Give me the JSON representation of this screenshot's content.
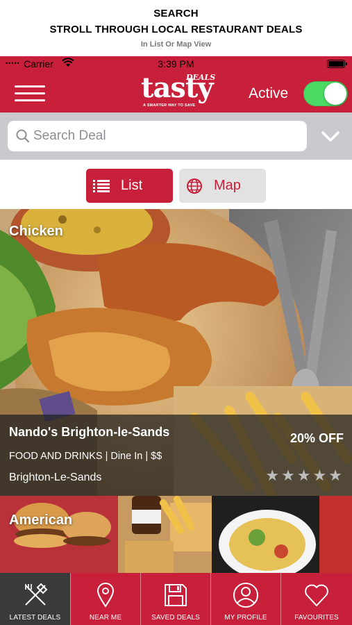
{
  "promo": {
    "line1": "SEARCH",
    "line2": "STROLL THROUGH LOCAL RESTAURANT DEALS",
    "line3": "In List Or Map View"
  },
  "status_bar": {
    "carrier": "Carrier",
    "time": "3:39 PM",
    "signal_dots": "•••••"
  },
  "header": {
    "logo_word": "tasty",
    "logo_deals": "DEALS",
    "logo_tagline": "A SMARTER WAY TO SAVE",
    "active_label": "Active",
    "active_toggle_on": true
  },
  "search": {
    "placeholder": "Search Deal"
  },
  "view_toggle": {
    "list_label": "List",
    "map_label": "Map",
    "selected": "List"
  },
  "deals": [
    {
      "category": "Chicken",
      "name": "Nando's Brighton-le-Sands",
      "discount": "20% OFF",
      "meta": "FOOD AND DRINKS | Dine In | $$",
      "location": "Brighton-Le-Sands",
      "rating": 0,
      "rating_max": 5
    },
    {
      "category": "American"
    }
  ],
  "tabs": [
    {
      "label": "LATEST DEALS",
      "icon": "fork-knife-icon",
      "active": true
    },
    {
      "label": "NEAR ME",
      "icon": "map-pin-icon",
      "active": false
    },
    {
      "label": "SAVED DEALS",
      "icon": "floppy-disk-icon",
      "active": false
    },
    {
      "label": "MY PROFILE",
      "icon": "user-icon",
      "active": false
    },
    {
      "label": "FAVOURITES",
      "icon": "heart-icon",
      "active": false
    }
  ],
  "colors": {
    "brand_red": "#c8203a",
    "toggle_green": "#4cd964",
    "active_tab": "#3a3a3a"
  }
}
